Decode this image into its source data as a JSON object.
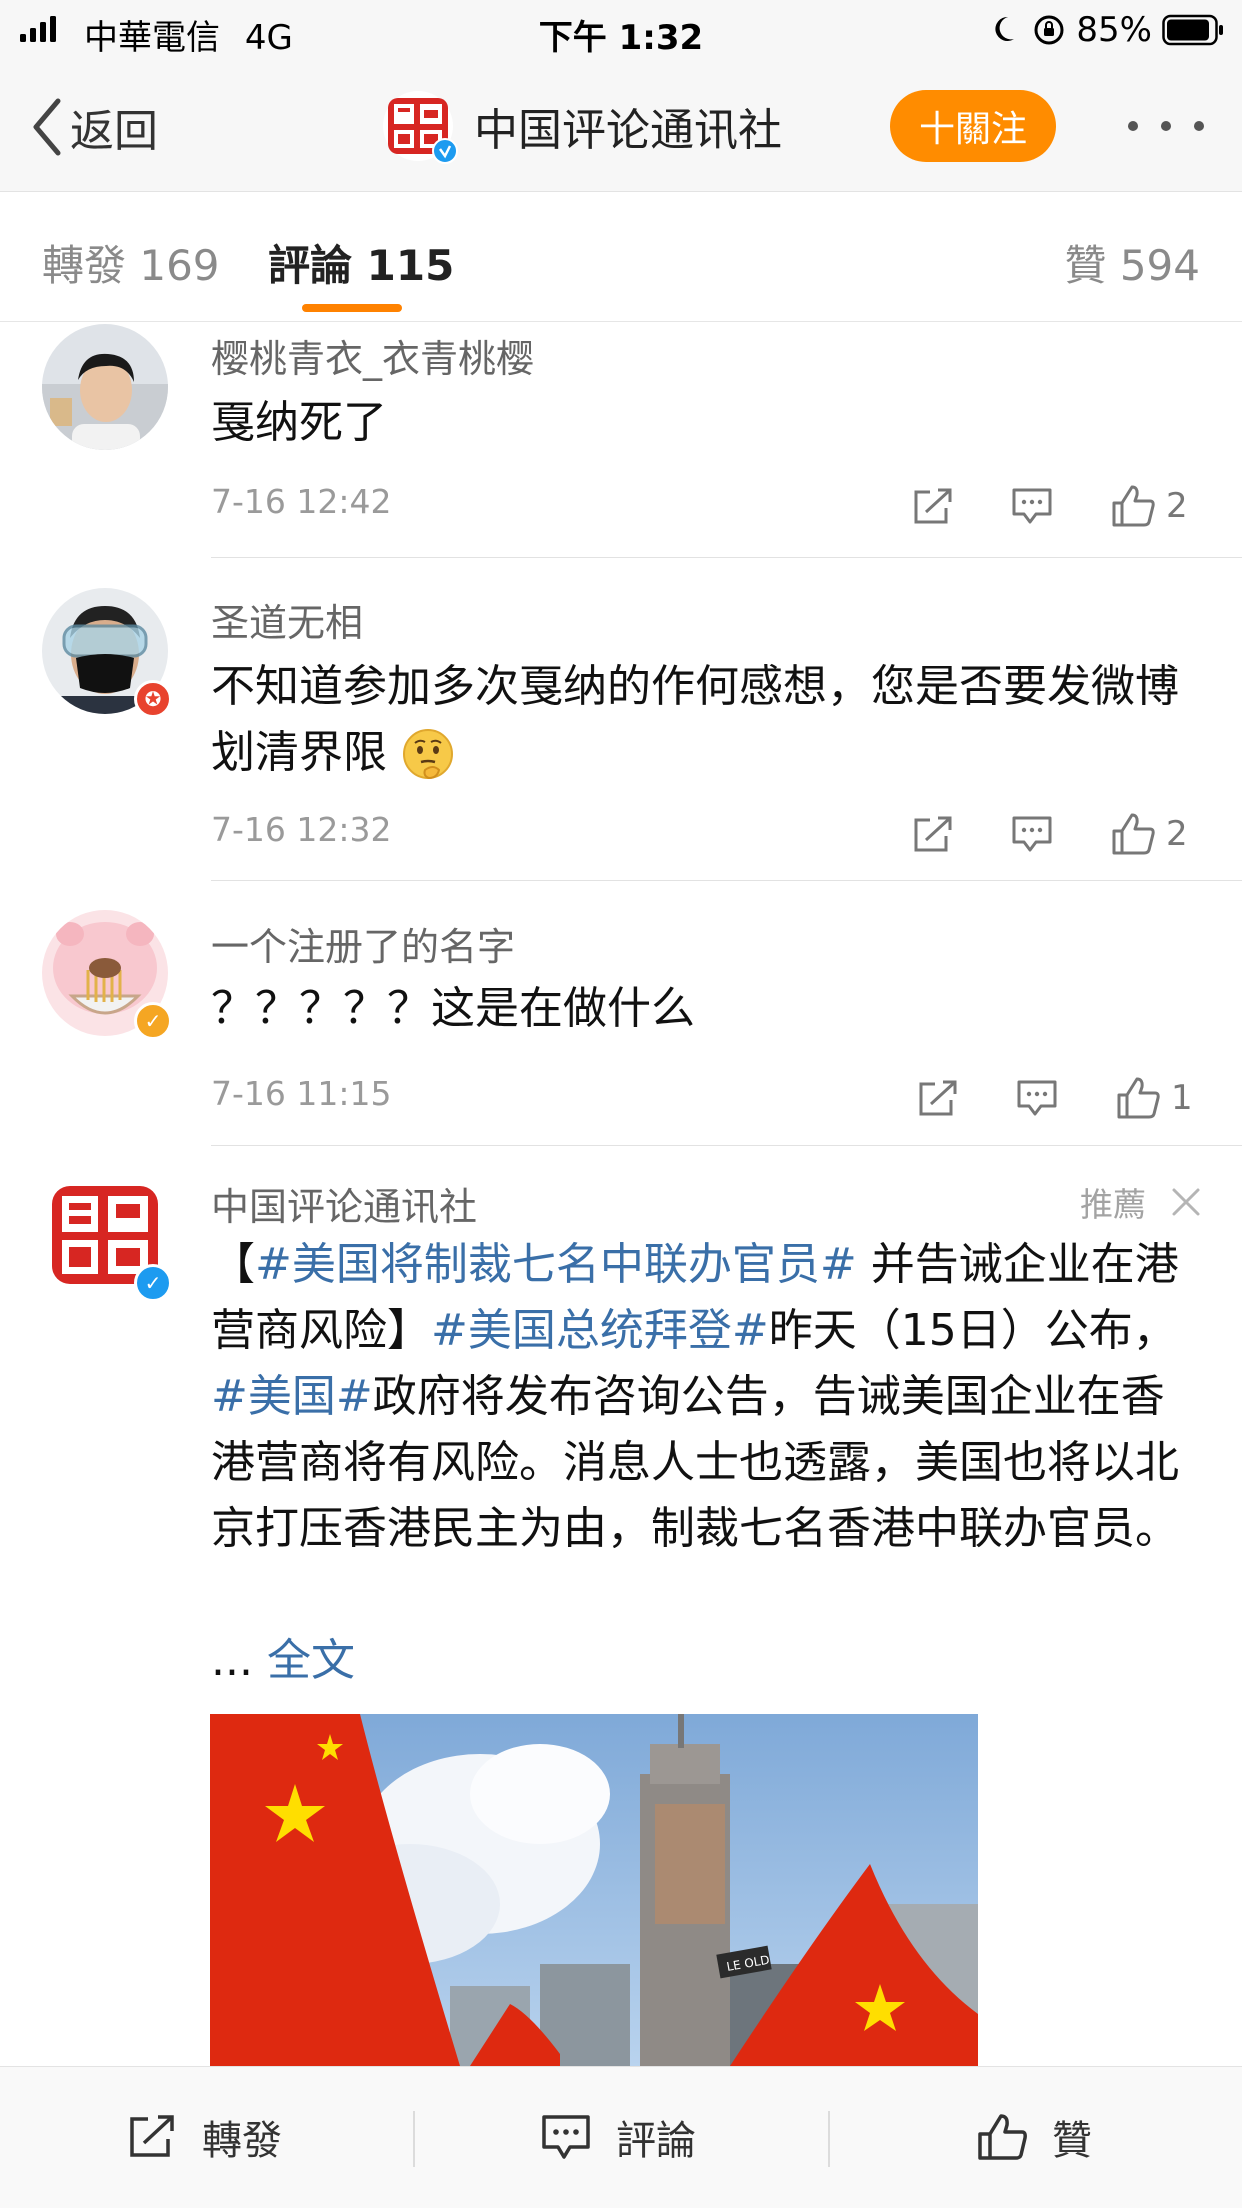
{
  "status_bar": {
    "carrier": "中華電信",
    "network": "4G",
    "time": "下午 1:32",
    "battery": "85%"
  },
  "nav": {
    "back_label": "返回",
    "title": "中国评论通讯社",
    "follow_label": "关注",
    "follow_prefix": "+",
    "follow_label_display": "十關注",
    "more_icon": "more-icon"
  },
  "tabs": {
    "repost": "轉發 169",
    "comments": "評論 115",
    "likes": "贊 594"
  },
  "comments": [
    {
      "name": "樱桃青衣_衣青桃樱",
      "text": "戛纳死了",
      "time": "7-16 12:42",
      "likes": "2"
    },
    {
      "name": "圣道无相",
      "text": "不知道参加多次戛纳的作何感想，您是否要发微博划清界限",
      "time": "7-16 12:32",
      "likes": "2"
    },
    {
      "name": "一个注册了的名字",
      "text": "？？？？？这是在做什么",
      "time": "7-16 11:15",
      "likes": "1"
    }
  ],
  "recommended": {
    "name": "中国评论通讯社",
    "label": "推薦",
    "text_parts": [
      {
        "t": "【",
        "h": false
      },
      {
        "t": "#美国将制裁七名中联办官员#",
        "h": true
      },
      {
        "t": " 并告诫企业在港营商风险】",
        "h": false
      },
      {
        "t": "#美国总统拜登#",
        "h": true
      },
      {
        "t": "昨天（15日）公布，",
        "h": false
      },
      {
        "t": "#美国#",
        "h": true
      },
      {
        "t": "政府将发布咨询公告，告诫美国企业在香港营商将有风险。消息人士也透露，美国也将以北京打压香港民主为由，制裁七名香港中联办官员。",
        "h": false
      }
    ],
    "ellipsis": "...",
    "full_text_link": "全文",
    "image_sign_text": "LE OLD"
  },
  "bottom_bar": {
    "repost": "轉發",
    "comment": "評論",
    "like": "贊"
  },
  "colors": {
    "accent": "#ff8200",
    "link": "#3a6fa8",
    "follow_button": "#ff8c00",
    "verified_blue": "#1d9bf0",
    "verified_gold": "#f5a623",
    "badge_red": "#e8432e"
  }
}
